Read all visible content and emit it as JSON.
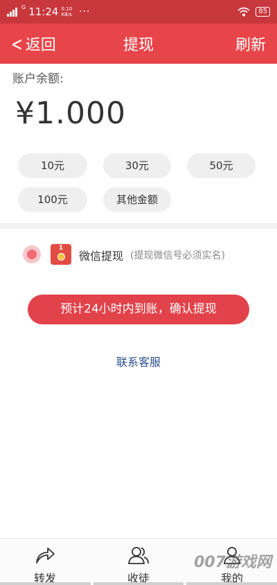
{
  "status_bar": {
    "network": "G",
    "time": "11:24",
    "speed_value": "0.10",
    "speed_unit": "KB/s",
    "dots": "···",
    "battery": "85"
  },
  "nav": {
    "back_label": "返回",
    "title": "提现",
    "refresh_label": "刷新"
  },
  "balance": {
    "label": "账户余额:",
    "amount": "¥1.000"
  },
  "amount_options": [
    {
      "label": "10元"
    },
    {
      "label": "30元"
    },
    {
      "label": "50元"
    },
    {
      "label": "100元"
    },
    {
      "label": "其他金额"
    }
  ],
  "method": {
    "icon_text": "1",
    "name": "微信提现",
    "note": "(提现微信号必须实名)"
  },
  "confirm_label": "预计24小时内到账，确认提现",
  "service_link": "联系客服",
  "tabs": [
    {
      "label": "转发",
      "icon": "share-icon"
    },
    {
      "label": "收徒",
      "icon": "users-icon"
    },
    {
      "label": "我的",
      "icon": "profile-icon"
    }
  ],
  "watermark": "007游戏网"
}
